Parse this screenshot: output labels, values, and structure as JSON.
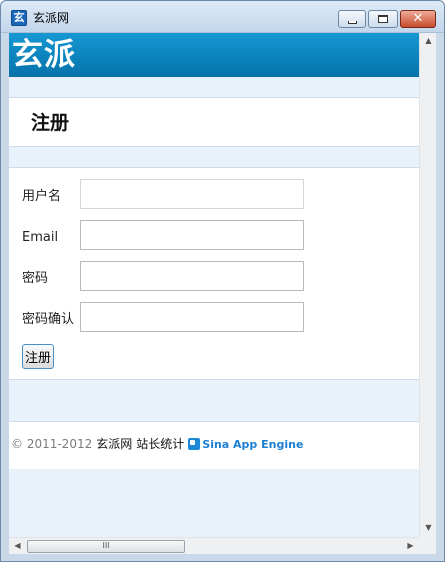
{
  "window": {
    "title": "玄派网",
    "icon_glyph": "玄",
    "minimize_icon": "minimize-icon",
    "maximize_icon": "maximize-icon",
    "close_icon": "close-icon",
    "close_glyph": "✕"
  },
  "site": {
    "logo_text": "玄派",
    "page_title": "注册",
    "brand_color": "#0a84c4"
  },
  "form": {
    "username_label": "用户名",
    "email_label": "Email",
    "password_label": "密码",
    "confirm_label": "密码确认",
    "username_value": "",
    "email_value": "",
    "password_value": "",
    "confirm_value": "",
    "submit_label": "注册"
  },
  "footer": {
    "copyright": "© 2011-2012",
    "site_link": "玄派网",
    "stats_link": "站长统计",
    "sae_text": "Sina  App Engine"
  },
  "scroll": {
    "up_arrow": "▲",
    "down_arrow": "▼",
    "left_arrow": "◀",
    "right_arrow": "▶",
    "grip": "III"
  }
}
